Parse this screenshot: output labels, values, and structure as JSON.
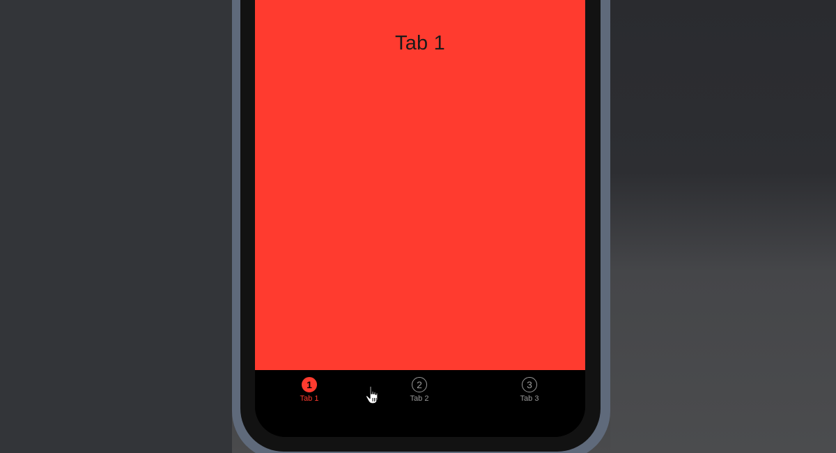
{
  "screen": {
    "title": "Tab 1",
    "background_color": "#ff3b2f"
  },
  "tabbar": {
    "tabs": [
      {
        "label": "Tab 1",
        "icon_glyph": "1",
        "icon": "number-1-circle-filled-icon",
        "active": true
      },
      {
        "label": "Tab 2",
        "icon_glyph": "2",
        "icon": "number-2-circle-icon",
        "active": false
      },
      {
        "label": "Tab 3",
        "icon_glyph": "3",
        "icon": "number-3-circle-icon",
        "active": false
      }
    ],
    "active_color": "#ff3b2f",
    "inactive_color": "#9a9a9a"
  },
  "cursor": {
    "icon": "hand-pointer-icon"
  }
}
